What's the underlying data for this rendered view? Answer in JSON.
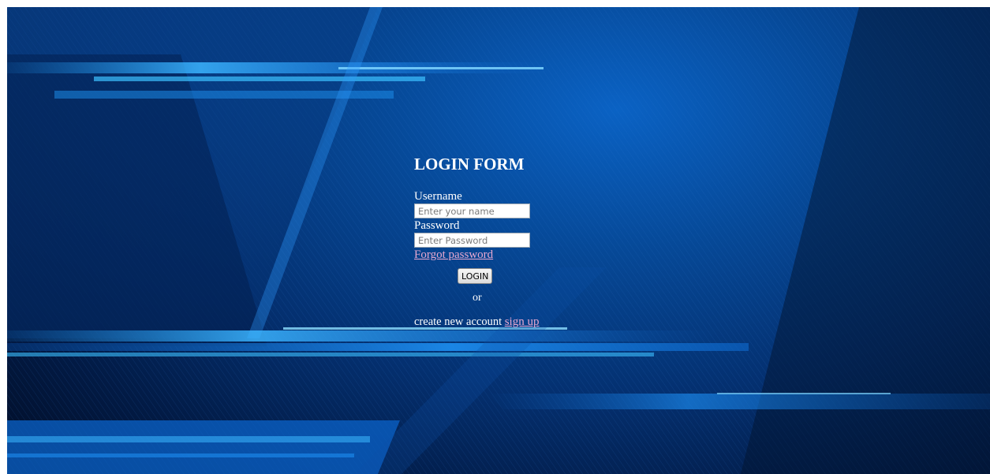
{
  "form": {
    "title": "LOGIN FORM",
    "username_label": "Username",
    "username_placeholder": "Enter your name",
    "password_label": "Password",
    "password_placeholder": "Enter Password",
    "forgot_link": "Forgot password",
    "login_button": "LOGIN",
    "or_text": "or",
    "signup_prefix": "create new account",
    "signup_link": "sign up"
  },
  "colors": {
    "background_primary": "#064896",
    "background_dark": "#010d25",
    "light_streak": "#1fa0ff",
    "text": "#ffffff",
    "link": "#e8a8d0"
  }
}
